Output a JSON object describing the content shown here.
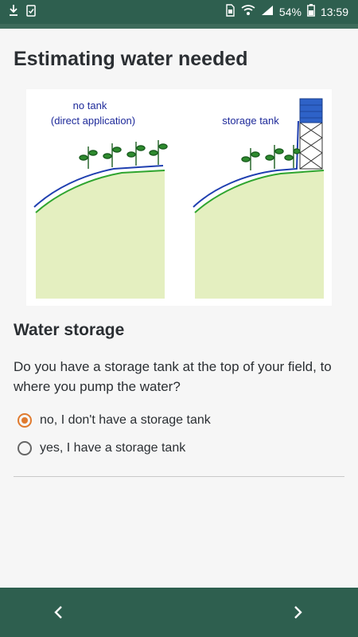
{
  "status": {
    "battery": "54%",
    "time": "13:59",
    "icons": [
      "download-icon",
      "clipboard-check-icon",
      "sim-icon",
      "wifi-icon",
      "signal-icon",
      "battery-icon"
    ]
  },
  "page": {
    "title": "Estimating water needed"
  },
  "illustration": {
    "left_label_line1": "no tank",
    "left_label_line2": "(direct application)",
    "right_label": "storage tank"
  },
  "section": {
    "title": "Water storage",
    "question": "Do you have a storage tank at the top of your field, to where you pump the water?"
  },
  "options": [
    {
      "label": "no, I don't have a storage tank",
      "checked": true
    },
    {
      "label": "yes, I have a storage tank",
      "checked": false
    }
  ],
  "nav": {
    "prev_icon": "chevron-left-icon",
    "next_icon": "chevron-right-icon"
  },
  "colors": {
    "bar": "#2e5f4f",
    "accent": "#e07a2e",
    "field_fill": "#e4efc0",
    "ground_line": "#2fa52f",
    "pipe": "#1f3fb0",
    "tank": "#2e62c8"
  }
}
